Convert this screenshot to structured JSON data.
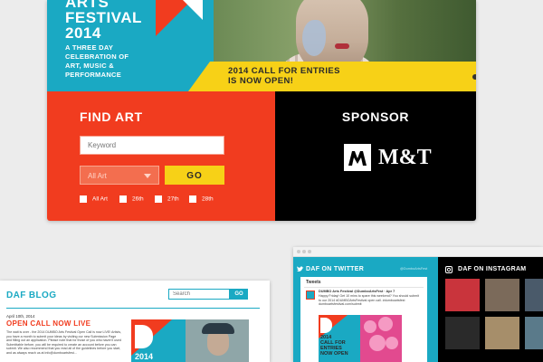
{
  "hero": {
    "title_line1": "ARTS",
    "title_line2": "FESTIVAL",
    "title_line3": "2014",
    "subtitle_lines": [
      "A THREE DAY",
      "CELEBRATION OF",
      "ART, MUSIC &",
      "PERFORMANCE"
    ],
    "banner_line1": "2014 CALL FOR ENTRIES",
    "banner_line2": "IS NOW OPEN!",
    "carousel_active_index": 0
  },
  "find_art": {
    "title": "FIND ART",
    "keyword_placeholder": "Keyword",
    "select_value": "All Art",
    "go_label": "GO",
    "checkboxes": [
      "All Art",
      "26th",
      "27th",
      "28th"
    ]
  },
  "sponsor": {
    "title": "SPONSOR",
    "logo_text": "M&T"
  },
  "blog": {
    "title": "DAF BLOG",
    "search_placeholder": "Search",
    "search_button": "GO",
    "post_date": "April 10th, 2014",
    "post_title": "OPEN CALL NOW LIVE",
    "post_body": "The wait is over - the 2014 DUMBO Arts Festival Open Call is now LIVE! Artists, you have a month to submit your ideas by visiting our new Submission Page and filling out an application. Please note that for those of you who haven't used Submittable before, you will be required to create an account before you can submit. We also recommend that you read all of the guidelines before you start, and as always reach us at info@dumboartsfest...",
    "image_year": "2014"
  },
  "twitter": {
    "title": "DAF ON TWITTER",
    "handle": "@DumboArtsFest",
    "tweets_label": "Tweets",
    "tweet_author": "DUMBO Arts Festival @DumboArtsFest · Apr 7",
    "tweet_text": "Happy Friday! Get 10 mins to spare this weekend? You should submit to our 2014 #DUMBOArtsFestival open call. #dumboartsfest dumboartsfestival.com/submit",
    "image_text_lines": [
      "2014",
      "CALL FOR",
      "ENTRIES",
      "NOW OPEN"
    ]
  },
  "instagram": {
    "title": "DAF ON INSTAGRAM",
    "tile_colors": [
      "#c9343c",
      "#7b6a5a",
      "#4a5a6a",
      "#2a2a2a",
      "#a68e6a",
      "#5a7a8a"
    ]
  },
  "colors": {
    "cyan": "#1aa9c3",
    "red": "#f13c1f",
    "yellow": "#f7d117",
    "black": "#000000"
  }
}
